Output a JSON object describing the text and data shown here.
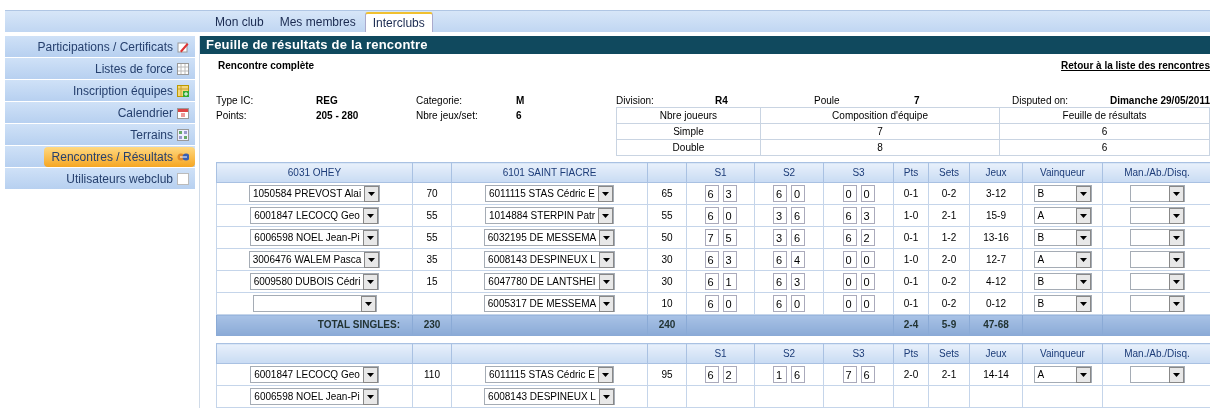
{
  "tabs": [
    {
      "label": "Mon club",
      "selected": false
    },
    {
      "label": "Mes membres",
      "selected": false
    },
    {
      "label": "Interclubs",
      "selected": true
    }
  ],
  "sidebar": {
    "items": [
      {
        "label": "Participations / Certificats",
        "selected": false
      },
      {
        "label": "Listes de force",
        "selected": false
      },
      {
        "label": "Inscription équipes",
        "selected": false
      },
      {
        "label": "Calendrier",
        "selected": false
      },
      {
        "label": "Terrains",
        "selected": false
      },
      {
        "label": "Rencontres / Résultats",
        "selected": true
      },
      {
        "label": "Utilisateurs webclub",
        "selected": false
      }
    ]
  },
  "panel": {
    "title": "Feuille de résultats de la rencontre",
    "status": "Rencontre complète",
    "back_link": "Retour à la liste des rencontres"
  },
  "info": [
    {
      "label": "Type IC:",
      "value": "REG"
    },
    {
      "label": "Categorie:",
      "value": "M"
    },
    {
      "label": "Points:",
      "value": "205 - 280"
    },
    {
      "label": "Nbre jeux/set:",
      "value": "6"
    }
  ],
  "match_info": [
    {
      "label": "Division:",
      "value": "R4"
    },
    {
      "label": "Poule",
      "value": "7"
    },
    {
      "label": "Disputed on:",
      "value": "Dimanche 29/05/2011"
    }
  ],
  "composition_table": {
    "columns": [
      "Nbre joueurs",
      "Composition d'équipe",
      "Feuille de résultats"
    ],
    "rows": [
      [
        "Simple",
        "7",
        "6"
      ],
      [
        "Double",
        "8",
        "6"
      ]
    ]
  },
  "singles": {
    "team_a": "6031 OHEY",
    "team_b": "6101 SAINT FIACRE",
    "score_columns": [
      "S1",
      "S2",
      "S3",
      "Pts",
      "Sets",
      "Jeux",
      "Vainqueur",
      "Man./Ab./Disq."
    ],
    "rows": [
      {
        "player_a": "1050584 PREVOST Alai",
        "points_a": "70",
        "player_b": "6011115 STAS Cédric E",
        "points_b": "65",
        "sets": [
          [
            "6",
            "3"
          ],
          [
            "6",
            "0"
          ],
          [
            "0",
            "0"
          ]
        ],
        "pts": "0-1",
        "sets_score": "0-2",
        "jeux": "3-12",
        "winner": "B"
      },
      {
        "player_a": "6001847 LECOCQ Geo",
        "points_a": "55",
        "player_b": "1014884 STERPIN Patr",
        "points_b": "55",
        "sets": [
          [
            "6",
            "0"
          ],
          [
            "3",
            "6"
          ],
          [
            "6",
            "3"
          ]
        ],
        "pts": "1-0",
        "sets_score": "2-1",
        "jeux": "15-9",
        "winner": "A"
      },
      {
        "player_a": "6006598 NOEL Jean-Pi",
        "points_a": "55",
        "player_b": "6032195 DE MESSEMA",
        "points_b": "50",
        "sets": [
          [
            "7",
            "5"
          ],
          [
            "3",
            "6"
          ],
          [
            "6",
            "2"
          ]
        ],
        "pts": "0-1",
        "sets_score": "1-2",
        "jeux": "13-16",
        "winner": "B"
      },
      {
        "player_a": "3006476 WALEM Pasca",
        "points_a": "35",
        "player_b": "6008143 DESPINEUX L",
        "points_b": "30",
        "sets": [
          [
            "6",
            "3"
          ],
          [
            "6",
            "4"
          ],
          [
            "0",
            "0"
          ]
        ],
        "pts": "1-0",
        "sets_score": "2-0",
        "jeux": "12-7",
        "winner": "A"
      },
      {
        "player_a": "6009580 DUBOIS Cédri",
        "points_a": "15",
        "player_b": "6047780 DE LANTSHEI",
        "points_b": "30",
        "sets": [
          [
            "6",
            "1"
          ],
          [
            "6",
            "3"
          ],
          [
            "0",
            "0"
          ]
        ],
        "pts": "0-1",
        "sets_score": "0-2",
        "jeux": "4-12",
        "winner": "B"
      },
      {
        "player_b": "6005317 DE MESSEMA",
        "points_b": "10",
        "sets": [
          [
            "6",
            "0"
          ],
          [
            "6",
            "0"
          ],
          [
            "0",
            "0"
          ]
        ],
        "pts": "0-1",
        "sets_score": "0-2",
        "jeux": "0-12",
        "winner": "B"
      }
    ],
    "total": {
      "label": "TOTAL SINGLES:",
      "points_a": "230",
      "points_b": "240",
      "pts": "2-4",
      "sets": "5-9",
      "jeux": "47-68"
    }
  },
  "doubles": {
    "score_columns": [
      "S1",
      "S2",
      "S3",
      "Pts",
      "Sets",
      "Jeux",
      "Vainqueur",
      "Man./Ab./Disq."
    ],
    "rows": [
      {
        "player_a": "6001847 LECOCQ Geo",
        "points_a": "110",
        "player_b": "6011115 STAS Cédric E",
        "points_b": "95",
        "sets": [
          [
            "6",
            "2"
          ],
          [
            "1",
            "6"
          ],
          [
            "7",
            "6"
          ]
        ],
        "pts": "2-0",
        "sets_score": "2-1",
        "jeux": "14-14",
        "winner": "A"
      },
      {
        "player_a": "6006598 NOEL Jean-Pi",
        "player_b": "6008143 DESPINEUX L"
      }
    ]
  }
}
